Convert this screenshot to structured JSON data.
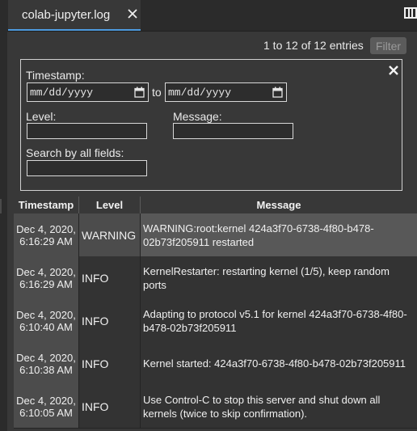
{
  "tab": {
    "title": "colab-jupyter.log"
  },
  "header": {
    "entries": "1 to 12 of 12 entries",
    "filter_label": "Filter"
  },
  "filters": {
    "timestamp_label": "Timestamp:",
    "date_from": "mm/dd/yyyy",
    "to_label": "to",
    "date_to": "mm/dd/yyyy",
    "level_label": "Level:",
    "level_value": "",
    "message_label": "Message:",
    "message_value": "",
    "search_label": "Search by all fields:",
    "search_value": ""
  },
  "table": {
    "columns": [
      "Timestamp",
      "Level",
      "Message"
    ],
    "rows": [
      {
        "timestamp": "Dec 4, 2020, 6:16:29 AM",
        "level": "WARNING",
        "message": "WARNING:root:kernel 424a3f70-6738-4f80-b478-\n02b73f205911 restarted"
      },
      {
        "timestamp": "Dec 4, 2020, 6:16:29 AM",
        "level": "INFO",
        "message": "KernelRestarter: restarting kernel (1/5), keep random\nports"
      },
      {
        "timestamp": "Dec 4, 2020, 6:10:40 AM",
        "level": "INFO",
        "message": "Adapting to protocol v5.1 for kernel 424a3f70-6738-4f80-\nb478-02b73f205911"
      },
      {
        "timestamp": "Dec 4, 2020, 6:10:38 AM",
        "level": "INFO",
        "message": "Kernel started: 424a3f70-6738-4f80-b478-02b73f205911"
      },
      {
        "timestamp": "Dec 4, 2020, 6:10:05 AM",
        "level": "INFO",
        "message": "Use Control-C to stop this server and shut down all\nkernels (twice to skip confirmation)."
      }
    ]
  },
  "icons": {
    "tab_close": "close-icon",
    "panel_toggle": "panel-toggle-icon",
    "filter_close": "close-icon",
    "calendar": "calendar-icon"
  },
  "colors": {
    "accent": "#4e9be0",
    "background": "#383838"
  }
}
